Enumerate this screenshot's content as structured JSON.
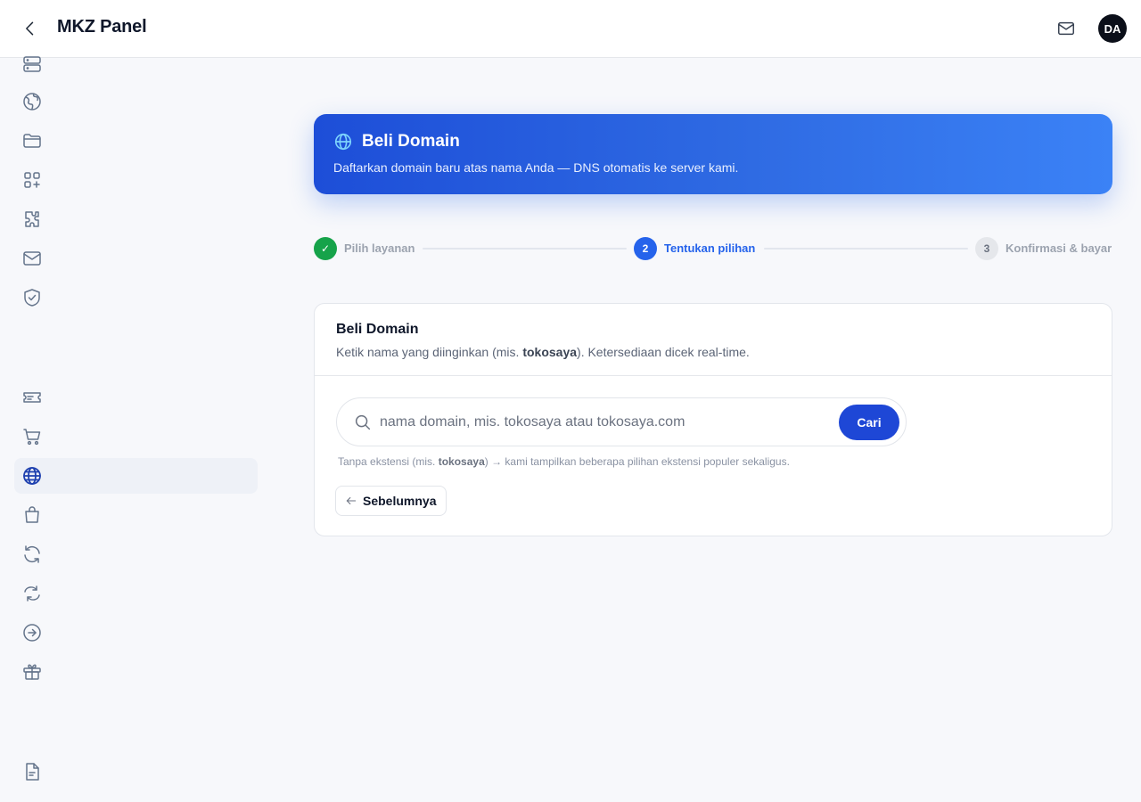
{
  "header": {
    "title": "MKZ Panel",
    "avatar_initials": "DA"
  },
  "sidebar": {
    "items": [
      {
        "icon": "server-icon",
        "active": false
      },
      {
        "icon": "globe-icon",
        "active": false
      },
      {
        "icon": "folder-icon",
        "active": false
      },
      {
        "icon": "apps-add-icon",
        "active": false
      },
      {
        "icon": "puzzle-icon",
        "active": false
      },
      {
        "icon": "mail-icon",
        "active": false
      },
      {
        "icon": "shield-check-icon",
        "active": false
      },
      {
        "icon": "ticket-icon",
        "active": false
      },
      {
        "icon": "cart-icon",
        "active": false
      },
      {
        "icon": "domain-globe-icon",
        "active": true
      },
      {
        "icon": "shopping-bag-icon",
        "active": false
      },
      {
        "icon": "refresh-icon",
        "active": false
      },
      {
        "icon": "sync-icon",
        "active": false
      },
      {
        "icon": "arrow-circle-right-icon",
        "active": false
      },
      {
        "icon": "gift-icon",
        "active": false
      },
      {
        "icon": "document-icon",
        "active": false
      }
    ]
  },
  "hero": {
    "title": "Beli Domain",
    "subtitle": "Daftarkan domain baru atas nama Anda — DNS otomatis ke server kami."
  },
  "stepper": {
    "steps": [
      {
        "number": "✓",
        "label": "Pilih layanan",
        "state": "done"
      },
      {
        "number": "2",
        "label": "Tentukan pilihan",
        "state": "current"
      },
      {
        "number": "3",
        "label": "Konfirmasi & bayar",
        "state": "upcoming"
      }
    ]
  },
  "card": {
    "title": "Beli Domain",
    "desc_prefix": "Ketik nama yang diinginkan (mis. ",
    "desc_bold": "tokosaya",
    "desc_suffix": "). Ketersediaan dicek real-time.",
    "search": {
      "value": "",
      "placeholder": "nama domain, mis. tokosaya atau tokosaya.com",
      "button_label": "Cari"
    },
    "hint_prefix": "Tanpa ekstensi (mis. ",
    "hint_bold": "tokosaya",
    "hint_suffix": ") → kami tampilkan beberapa pilihan ekstensi populer sekaligus.",
    "prev_label": "Sebelumnya"
  },
  "colors": {
    "accent": "#1e47d6",
    "step_done": "#16a34a",
    "step_current": "#2563eb",
    "step_upcoming_bg": "#e5e7eb"
  }
}
